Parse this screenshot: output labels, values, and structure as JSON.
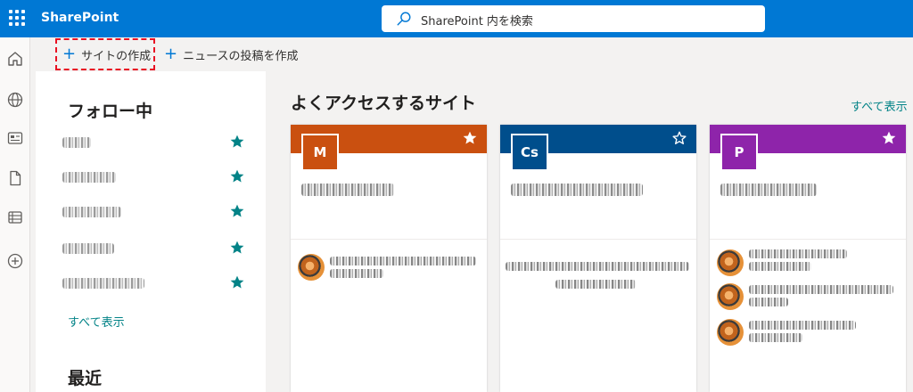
{
  "header": {
    "app_name": "SharePoint",
    "search_placeholder": "SharePoint 内を検索"
  },
  "commands": {
    "create_site": "サイトの作成",
    "post_news": "ニュースの投稿を作成"
  },
  "following": {
    "title": "フォロー中",
    "see_all": "すべて表示",
    "recent_title": "最近"
  },
  "frequent": {
    "title": "よくアクセスするサイト",
    "see_all": "すべて表示",
    "sites": [
      {
        "initials": "M",
        "color": "#ca5010",
        "starred": true
      },
      {
        "initials": "Cs",
        "color": "#004e8c",
        "starred": false
      },
      {
        "initials": "P",
        "color": "#8e24aa",
        "starred": true
      }
    ]
  },
  "colors": {
    "suite_bar": "#0078d4",
    "accent_teal": "#038387",
    "highlight_border": "#e81123"
  }
}
